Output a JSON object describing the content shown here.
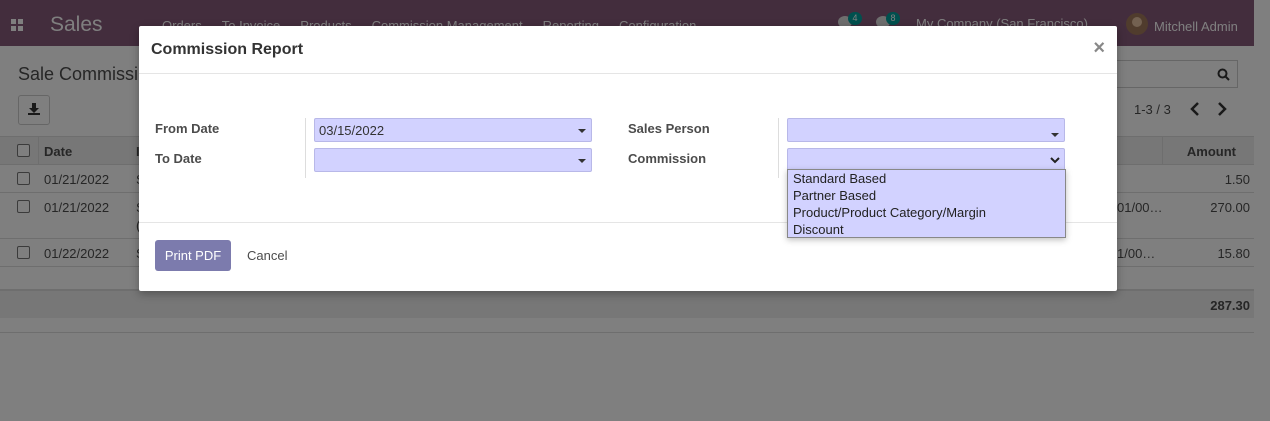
{
  "app": {
    "brand": "Sales",
    "menu": [
      "Orders",
      "To Invoice",
      "Products",
      "Commission Management",
      "Reporting",
      "Configuration"
    ],
    "activity_count": "4",
    "message_count": "8",
    "company": "My Company (San Francisco)",
    "user": "Mitchell Admin"
  },
  "control_panel": {
    "title": "Sale Commissi",
    "pager": "1-3 / 3"
  },
  "list": {
    "col_date": "Date",
    "col_second": "I",
    "col_amount": "Amount",
    "rows": [
      {
        "date": "01/21/2022",
        "col2": "S",
        "col2b": "",
        "mid": "",
        "amount": "1.50"
      },
      {
        "date": "01/21/2022",
        "col2": "S",
        "col2b": "(",
        "mid": "01/00…",
        "amount": "270.00"
      },
      {
        "date": "01/22/2022",
        "col2": "S",
        "col2b": "",
        "mid": "1/00…",
        "amount": "15.80"
      }
    ],
    "total": "287.30"
  },
  "modal": {
    "title": "Commission Report",
    "close": "×",
    "from_date_label": "From Date",
    "from_date_value": "03/15/2022",
    "to_date_label": "To Date",
    "to_date_value": "",
    "sales_person_label": "Sales Person",
    "sales_person_value": "",
    "commission_label": "Commission",
    "commission_options": [
      "Standard Based",
      "Partner Based",
      "Product/Product Category/Margin",
      "Discount"
    ],
    "print_label": "Print PDF",
    "cancel_label": "Cancel"
  }
}
